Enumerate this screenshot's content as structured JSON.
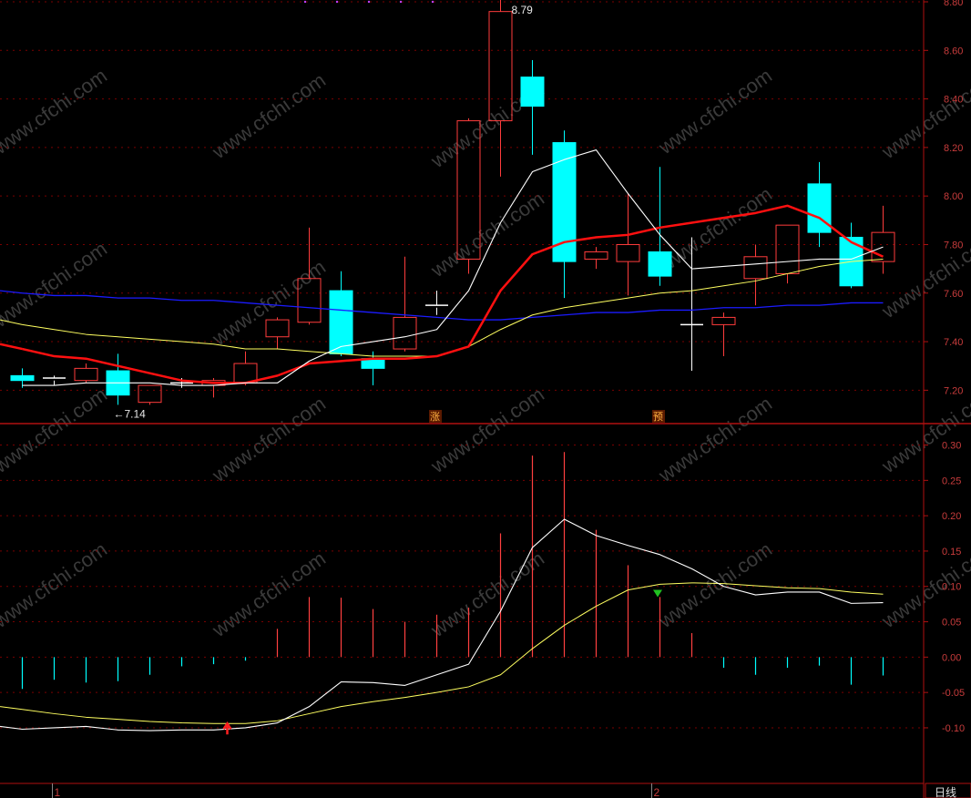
{
  "chart_data": [
    {
      "type": "candlestick",
      "panel": "price",
      "ylim": [
        7.1,
        8.8
      ],
      "yticks": [
        "8.80",
        "8.60",
        "8.40",
        "8.20",
        "8.00",
        "7.80",
        "7.60",
        "7.40",
        "7.20"
      ],
      "grid": true,
      "colors": {
        "up": "#ff3c3c",
        "down": "#00ffff",
        "cross": "#ffffff",
        "ma5": "#ffffff",
        "ma10": "#ff1010",
        "ma20": "#ffff60",
        "ma60": "#1b1bff",
        "grid": "#7a0000",
        "axis": "#b01010",
        "tick": "#c83c3c"
      },
      "candles": [
        {
          "o": 7.26,
          "h": 7.29,
          "l": 7.21,
          "c": 7.24
        },
        {
          "o": 7.24,
          "h": 7.26,
          "l": 7.22,
          "c": 7.25
        },
        {
          "o": 7.24,
          "h": 7.31,
          "l": 7.23,
          "c": 7.29
        },
        {
          "o": 7.28,
          "h": 7.35,
          "l": 7.14,
          "c": 7.18
        },
        {
          "o": 7.15,
          "h": 7.22,
          "l": 7.14,
          "c": 7.22
        },
        {
          "o": 7.23,
          "h": 7.25,
          "l": 7.21,
          "c": 7.23
        },
        {
          "o": 7.22,
          "h": 7.25,
          "l": 7.17,
          "c": 7.24
        },
        {
          "o": 7.23,
          "h": 7.36,
          "l": 7.22,
          "c": 7.31
        },
        {
          "o": 7.42,
          "h": 7.5,
          "l": 7.37,
          "c": 7.49
        },
        {
          "o": 7.48,
          "h": 7.87,
          "l": 7.47,
          "c": 7.66
        },
        {
          "o": 7.61,
          "h": 7.69,
          "l": 7.34,
          "c": 7.35
        },
        {
          "o": 7.33,
          "h": 7.36,
          "l": 7.22,
          "c": 7.29
        },
        {
          "o": 7.37,
          "h": 7.75,
          "l": 7.36,
          "c": 7.5
        },
        {
          "o": 7.54,
          "h": 7.61,
          "l": 7.51,
          "c": 7.55
        },
        {
          "o": 7.74,
          "h": 8.32,
          "l": 7.68,
          "c": 8.31
        },
        {
          "o": 8.31,
          "h": 8.81,
          "l": 8.08,
          "c": 8.76
        },
        {
          "o": 8.49,
          "h": 8.56,
          "l": 8.17,
          "c": 8.37
        },
        {
          "o": 8.22,
          "h": 8.27,
          "l": 7.58,
          "c": 7.73
        },
        {
          "o": 7.74,
          "h": 7.79,
          "l": 7.7,
          "c": 7.77
        },
        {
          "o": 7.73,
          "h": 8.01,
          "l": 7.59,
          "c": 7.8
        },
        {
          "o": 7.77,
          "h": 8.12,
          "l": 7.63,
          "c": 7.67
        },
        {
          "o": 7.47,
          "h": 7.83,
          "l": 7.28,
          "c": 7.47
        },
        {
          "o": 7.47,
          "h": 7.52,
          "l": 7.34,
          "c": 7.5
        },
        {
          "o": 7.66,
          "h": 7.8,
          "l": 7.55,
          "c": 7.75
        },
        {
          "o": 7.68,
          "h": 7.88,
          "l": 7.64,
          "c": 7.88
        },
        {
          "o": 8.05,
          "h": 8.14,
          "l": 7.79,
          "c": 7.85
        },
        {
          "o": 7.83,
          "h": 7.89,
          "l": 7.62,
          "c": 7.63
        },
        {
          "o": 7.73,
          "h": 7.96,
          "l": 7.68,
          "c": 7.85
        }
      ],
      "ma5": [
        7.22,
        7.22,
        7.23,
        7.23,
        7.23,
        7.22,
        7.22,
        7.23,
        7.23,
        7.32,
        7.38,
        7.4,
        7.42,
        7.45,
        7.61,
        7.89,
        8.1,
        8.15,
        8.19,
        8.01,
        7.84,
        7.7,
        7.71,
        7.72,
        7.73,
        7.74,
        7.74,
        7.79
      ],
      "ma10": [
        7.37,
        7.34,
        7.33,
        7.3,
        7.27,
        7.24,
        7.23,
        7.23,
        7.26,
        7.31,
        7.32,
        7.33,
        7.33,
        7.34,
        7.38,
        7.61,
        7.76,
        7.81,
        7.83,
        7.84,
        7.87,
        7.89,
        7.91,
        7.93,
        7.96,
        7.91,
        7.81,
        7.75
      ],
      "ma20": [
        7.47,
        7.45,
        7.43,
        7.42,
        7.41,
        7.4,
        7.39,
        7.37,
        7.37,
        7.36,
        7.35,
        7.34,
        7.34,
        7.34,
        7.38,
        7.45,
        7.51,
        7.54,
        7.56,
        7.58,
        7.6,
        7.61,
        7.63,
        7.65,
        7.68,
        7.71,
        7.73,
        7.74
      ],
      "ma60": [
        7.6,
        7.59,
        7.59,
        7.58,
        7.58,
        7.57,
        7.57,
        7.56,
        7.55,
        7.54,
        7.53,
        7.52,
        7.51,
        7.5,
        7.49,
        7.49,
        7.5,
        7.51,
        7.52,
        7.52,
        7.53,
        7.53,
        7.54,
        7.54,
        7.55,
        7.55,
        7.56,
        7.56
      ],
      "annotations": [
        {
          "text": "8.79",
          "index": 15,
          "value": 8.8,
          "kind": "high"
        },
        {
          "text": "←7.14",
          "index": 3,
          "value": 7.14,
          "kind": "low"
        }
      ],
      "markers": [
        {
          "text": "涨",
          "index": 13
        },
        {
          "text": "预",
          "index": 20
        }
      ],
      "x_labels": [
        {
          "text": "1",
          "index": 1.3
        },
        {
          "text": "2",
          "index": 20.1
        }
      ]
    },
    {
      "type": "bar+line",
      "panel": "indicator",
      "ylim": [
        -0.14,
        0.32
      ],
      "yticks": [
        "0.30",
        "0.25",
        "0.20",
        "0.15",
        "0.10",
        "0.05",
        "0.00",
        "-0.05",
        "-0.10"
      ],
      "grid": true,
      "bars": [
        -0.045,
        -0.032,
        -0.036,
        -0.034,
        -0.025,
        -0.013,
        -0.01,
        -0.005,
        0.04,
        0.085,
        0.084,
        0.068,
        0.05,
        0.06,
        0.07,
        0.175,
        0.285,
        0.29,
        0.18,
        0.13,
        0.085,
        0.034,
        -0.015,
        -0.025,
        -0.015,
        -0.012,
        -0.039,
        -0.026
      ],
      "line_white": [
        -0.102,
        -0.1,
        -0.098,
        -0.103,
        -0.104,
        -0.103,
        -0.103,
        -0.1,
        -0.093,
        -0.07,
        -0.035,
        -0.036,
        -0.04,
        -0.025,
        -0.01,
        0.065,
        0.155,
        0.195,
        0.172,
        0.158,
        0.145,
        0.125,
        0.1,
        0.088,
        0.092,
        0.092,
        0.076,
        0.077
      ],
      "line_yellow": [
        -0.074,
        -0.08,
        -0.085,
        -0.088,
        -0.091,
        -0.093,
        -0.094,
        -0.094,
        -0.09,
        -0.08,
        -0.07,
        -0.063,
        -0.057,
        -0.05,
        -0.042,
        -0.025,
        0.012,
        0.045,
        0.072,
        0.095,
        0.103,
        0.105,
        0.104,
        0.101,
        0.098,
        0.097,
        0.092,
        0.089
      ],
      "signals": [
        {
          "kind": "buy",
          "index": 6.6,
          "value": -0.094
        },
        {
          "kind": "sell",
          "index": 20.1,
          "value": 0.09
        }
      ]
    }
  ],
  "period_label": "日线",
  "watermark_text": "www.cfchi.com"
}
